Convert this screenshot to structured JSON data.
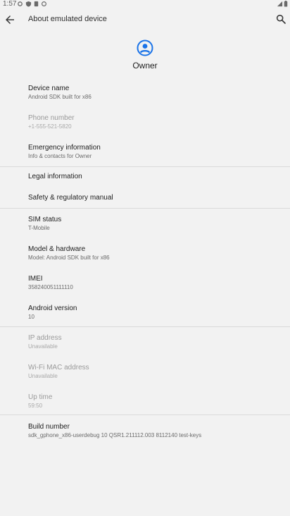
{
  "status_bar": {
    "time": "1:57"
  },
  "toolbar": {
    "title": "About emulated device"
  },
  "profile": {
    "name": "Owner"
  },
  "items": [
    {
      "title": "Device name",
      "summary": "Android SDK built for x86"
    },
    {
      "title": "Phone number",
      "summary": "+1-555-521-5820"
    },
    {
      "title": "Emergency information",
      "summary": "Info & contacts for Owner"
    },
    {
      "title": "Legal information"
    },
    {
      "title": "Safety & regulatory manual"
    },
    {
      "title": "SIM status",
      "summary": "T-Mobile"
    },
    {
      "title": "Model & hardware",
      "summary": "Model: Android SDK built for x86"
    },
    {
      "title": "IMEI",
      "summary": "358240051111110"
    },
    {
      "title": "Android version",
      "summary": "10"
    },
    {
      "title": "IP address",
      "summary": "Unavailable"
    },
    {
      "title": "Wi-Fi MAC address",
      "summary": "Unavailable"
    },
    {
      "title": "Up time",
      "summary": "59:50"
    },
    {
      "title": "Build number",
      "summary": "sdk_gphone_x86-userdebug 10 QSR1.211112.003 8112140 test-keys"
    }
  ],
  "colors": {
    "accent": "#1a73e8",
    "divider": "#dadada",
    "background": "#f2f2f2"
  },
  "icons": [
    "signal-icon",
    "battery-icon",
    "back-arrow-icon",
    "search-icon",
    "account-circle-icon"
  ]
}
